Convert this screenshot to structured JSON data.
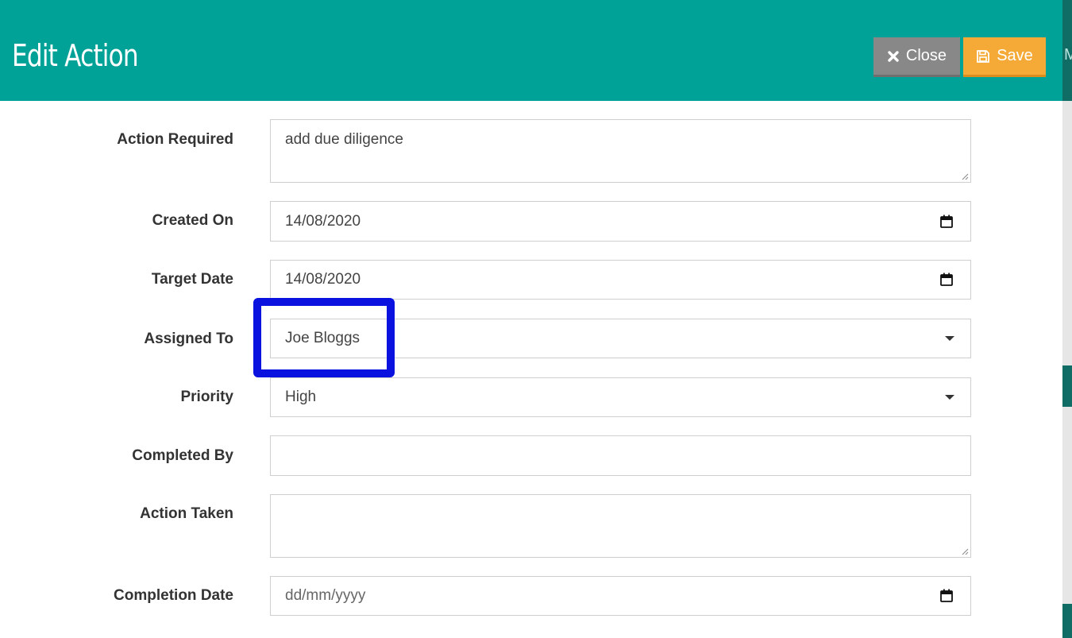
{
  "header": {
    "title": "Edit Action",
    "close_label": "Close",
    "save_label": "Save",
    "side_letter": "M"
  },
  "form": {
    "action_required": {
      "label": "Action Required",
      "value": "add due diligence"
    },
    "created_on": {
      "label": "Created On",
      "value": "14/08/2020"
    },
    "target_date": {
      "label": "Target Date",
      "value": "14/08/2020"
    },
    "assigned_to": {
      "label": "Assigned To",
      "value": "Joe Bloggs"
    },
    "priority": {
      "label": "Priority",
      "value": "High"
    },
    "completed_by": {
      "label": "Completed By",
      "value": ""
    },
    "action_taken": {
      "label": "Action Taken",
      "value": ""
    },
    "completion_date": {
      "label": "Completion Date",
      "placeholder": "dd/mm/yyyy"
    }
  },
  "colors": {
    "header_bg": "#00a297",
    "close_bg": "#888888",
    "save_bg": "#f5a937",
    "highlight": "#0a12e0"
  },
  "icons": {
    "close": "close-x-icon",
    "save": "floppy-disk-icon",
    "date": "calendar-icon",
    "select": "caret-down-icon"
  }
}
